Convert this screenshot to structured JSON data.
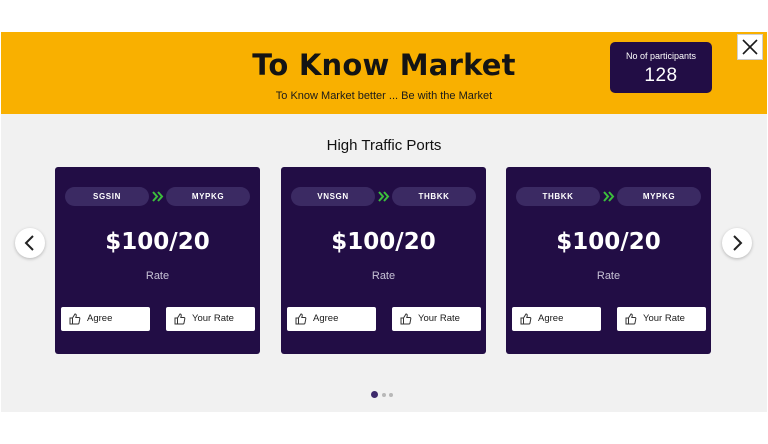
{
  "header": {
    "title": "To Know Market",
    "subtitle": "To Know Market better ... Be with the Market",
    "participants_label": "No of participants",
    "participants_count": "128",
    "background_color": "#f9b000",
    "close_icon": "close-icon"
  },
  "section": {
    "title": "High Traffic Ports"
  },
  "cards": [
    {
      "from": "SGSIN",
      "to": "MYPKG",
      "rate": "$100/20",
      "rate_label": "Rate",
      "agree_label": "Agree",
      "your_rate_label": "Your Rate"
    },
    {
      "from": "VNSGN",
      "to": "THBKK",
      "rate": "$100/20",
      "rate_label": "Rate",
      "agree_label": "Agree",
      "your_rate_label": "Your Rate"
    },
    {
      "from": "THBKK",
      "to": "MYPKG",
      "rate": "$100/20",
      "rate_label": "Rate",
      "agree_label": "Agree",
      "your_rate_label": "Your Rate"
    }
  ],
  "carousel": {
    "prev_icon": "chevron-left-icon",
    "next_icon": "chevron-right-icon",
    "page_count": 3,
    "active_page": 1
  },
  "colors": {
    "card_bg": "#220d45",
    "accent_arrow": "#3cbf3c",
    "port_pill": "#3b2a63"
  }
}
